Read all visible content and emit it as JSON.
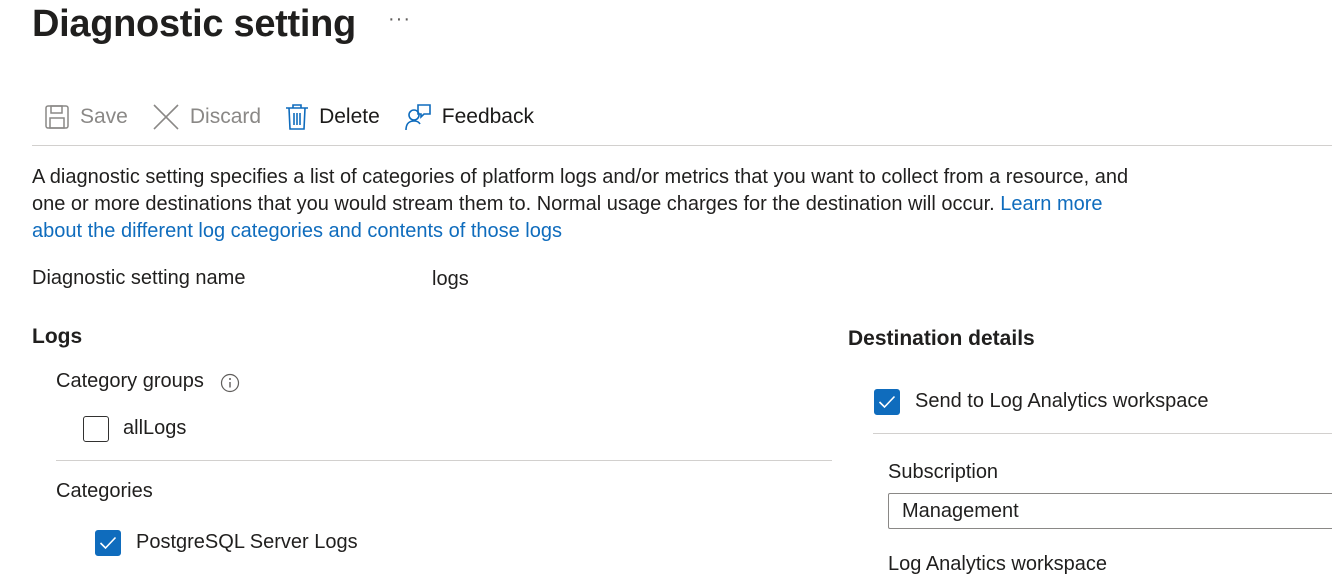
{
  "header": {
    "title": "Diagnostic setting",
    "more_label": "···"
  },
  "toolbar": {
    "save_label": "Save",
    "discard_label": "Discard",
    "delete_label": "Delete",
    "feedback_label": "Feedback"
  },
  "description": {
    "text": "A diagnostic setting specifies a list of categories of platform logs and/or metrics that you want to collect from a resource, and one or more destinations that you would stream them to. Normal usage charges for the destination will occur. ",
    "link_text": "Learn more about the different log categories and contents of those logs"
  },
  "setting_name": {
    "label": "Diagnostic setting name",
    "value": "logs"
  },
  "logs": {
    "title": "Logs",
    "category_groups_label": "Category groups",
    "all_logs_label": "allLogs",
    "all_logs_checked": false,
    "categories_label": "Categories",
    "postgres_label": "PostgreSQL Server Logs",
    "postgres_checked": true
  },
  "destination": {
    "title": "Destination details",
    "send_law_label": "Send to Log Analytics workspace",
    "send_law_checked": true,
    "subscription_label": "Subscription",
    "subscription_value": "Management",
    "workspace_label": "Log Analytics workspace"
  },
  "colors": {
    "accent": "#0f6cbd",
    "text": "#201f1e",
    "muted": "#8a8886",
    "border": "#d2d0ce"
  }
}
